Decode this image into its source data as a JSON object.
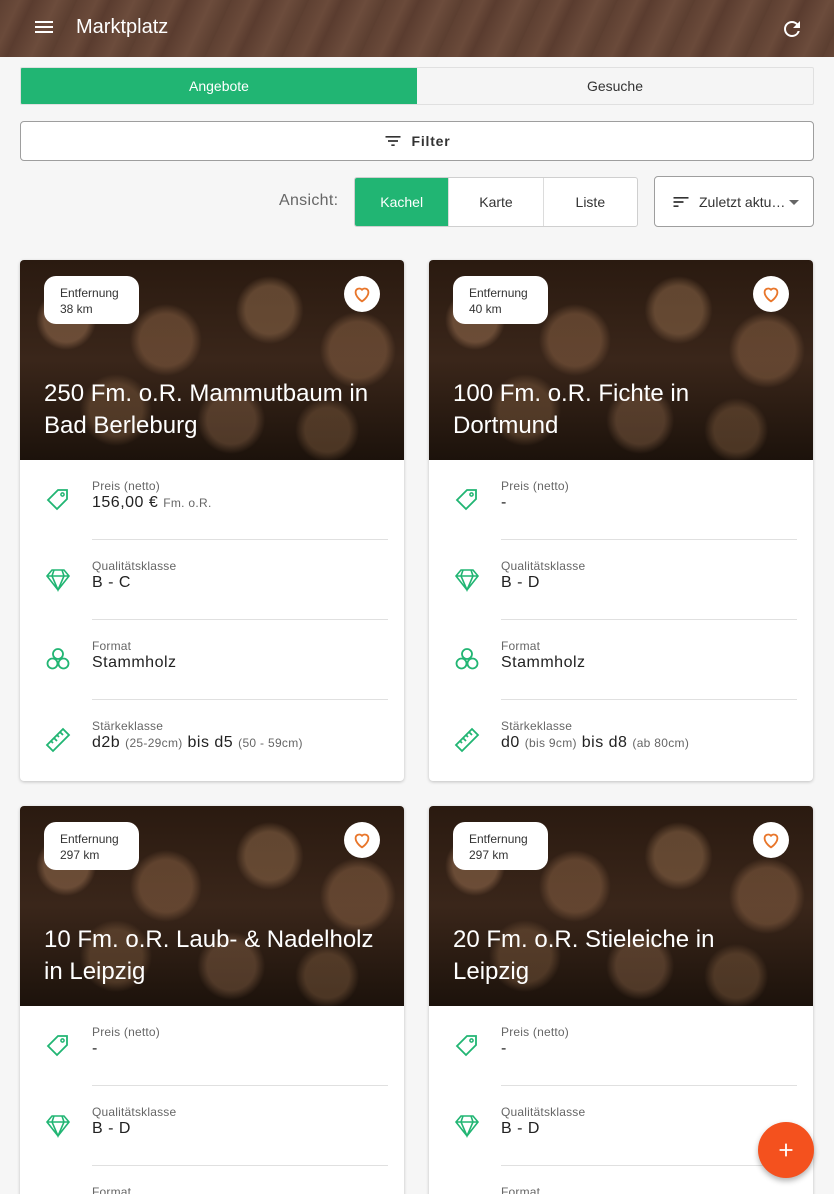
{
  "appbar": {
    "title": "Marktplatz",
    "menu_icon": "menu-icon",
    "refresh_icon": "refresh-icon"
  },
  "tabs": [
    {
      "label": "Angebote",
      "active": true
    },
    {
      "label": "Gesuche",
      "active": false
    }
  ],
  "filter": {
    "label": "Filter",
    "icon": "filter-icon"
  },
  "view": {
    "label": "Ansicht:",
    "options": [
      {
        "label": "Kachel",
        "active": true
      },
      {
        "label": "Karte",
        "active": false
      },
      {
        "label": "Liste",
        "active": false
      }
    ]
  },
  "sort": {
    "label": "Zuletzt aktu…",
    "icon": "sort-icon"
  },
  "colors": {
    "accent": "#21b573",
    "fab": "#f4511e",
    "favorite": "#e8762b",
    "appbar": "#5e4032"
  },
  "listings": [
    {
      "distance_label": "Entfernung",
      "distance": "38 km",
      "title": "250 Fm. o.R. Mammutbaum in Bad Berleburg",
      "price_label": "Preis (netto)",
      "price": "156,00 €",
      "price_unit": "Fm. o.R.",
      "quality_label": "Qualitätsklasse",
      "quality": "B - C",
      "format_label": "Format",
      "format": "Stammholz",
      "strength_label": "Stärkeklasse",
      "strength_from": "d2b",
      "strength_from_range": "(25-29cm)",
      "strength_sep": "bis",
      "strength_to": "d5",
      "strength_to_range": "(50 - 59cm)"
    },
    {
      "distance_label": "Entfernung",
      "distance": "40 km",
      "title": "100 Fm. o.R. Fichte in Dortmund",
      "price_label": "Preis (netto)",
      "price": "-",
      "price_unit": "",
      "quality_label": "Qualitätsklasse",
      "quality": "B - D",
      "format_label": "Format",
      "format": "Stammholz",
      "strength_label": "Stärkeklasse",
      "strength_from": "d0",
      "strength_from_range": "(bis 9cm)",
      "strength_sep": "bis",
      "strength_to": "d8",
      "strength_to_range": "(ab 80cm)"
    },
    {
      "distance_label": "Entfernung",
      "distance": "297 km",
      "title": "10 Fm. o.R. Laub- & Nadelholz in Leipzig",
      "price_label": "Preis (netto)",
      "price": "-",
      "quality_label": "Qualitätsklasse",
      "quality": "B - D",
      "format_label": "Format"
    },
    {
      "distance_label": "Entfernung",
      "distance": "297 km",
      "title": "20 Fm. o.R. Stieleiche in Leipzig",
      "price_label": "Preis (netto)",
      "price": "-",
      "quality_label": "Qualitätsklasse",
      "quality": "B - D",
      "format_label": "Format"
    }
  ],
  "fab": {
    "icon": "add-icon"
  }
}
